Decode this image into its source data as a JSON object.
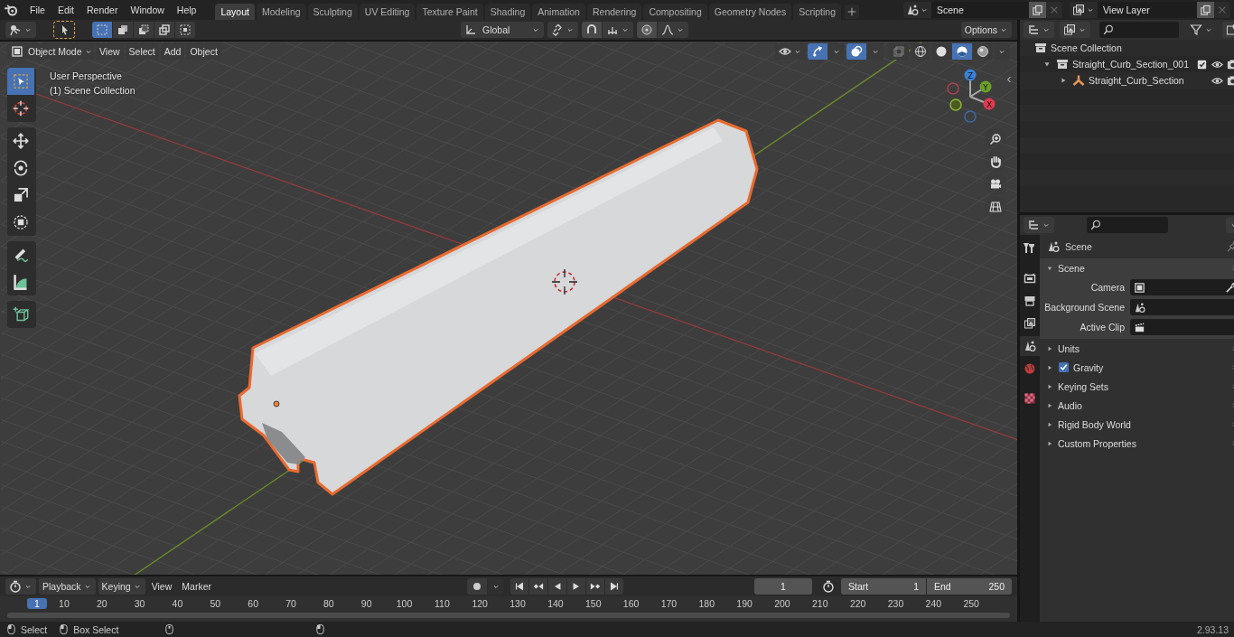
{
  "top_bar": {
    "menus": [
      "File",
      "Edit",
      "Render",
      "Window",
      "Help"
    ],
    "workspaces": [
      {
        "label": "Layout",
        "selected": true
      },
      {
        "label": "Modeling",
        "selected": false
      },
      {
        "label": "Sculpting",
        "selected": false
      },
      {
        "label": "UV Editing",
        "selected": false
      },
      {
        "label": "Texture Paint",
        "selected": false
      },
      {
        "label": "Shading",
        "selected": false
      },
      {
        "label": "Animation",
        "selected": false
      },
      {
        "label": "Rendering",
        "selected": false
      },
      {
        "label": "Compositing",
        "selected": false
      },
      {
        "label": "Geometry Nodes",
        "selected": false
      },
      {
        "label": "Scripting",
        "selected": false
      }
    ],
    "scene": "Scene",
    "view_layer": "View Layer"
  },
  "tool_header": {
    "select_modes": [
      {
        "kind": "set",
        "selected": true
      },
      {
        "kind": "extend",
        "selected": false
      },
      {
        "kind": "subtract",
        "selected": false
      },
      {
        "kind": "invert",
        "selected": false
      },
      {
        "kind": "intersect",
        "selected": false
      }
    ],
    "orientation": "Global",
    "options": "Options"
  },
  "viewport_header": {
    "mode": "Object Mode",
    "menus": [
      "View",
      "Select",
      "Add",
      "Object"
    ],
    "shading": [
      {
        "kind": "wireframe",
        "selected": false
      },
      {
        "kind": "solid",
        "selected": false
      },
      {
        "kind": "material",
        "selected": true
      },
      {
        "kind": "rendered",
        "selected": false
      }
    ]
  },
  "viewport": {
    "info": [
      "User Perspective",
      "(1) Scene Collection"
    ],
    "tools": [
      {
        "kind": "select",
        "selected": true
      },
      {
        "kind": "cursor",
        "selected": false
      },
      {
        "kind": "move",
        "selected": false
      },
      {
        "kind": "rotate",
        "selected": false
      },
      {
        "kind": "scale",
        "selected": false
      },
      {
        "kind": "transform",
        "selected": false
      },
      {
        "kind": "annotate",
        "selected": false
      },
      {
        "kind": "measure",
        "selected": false
      },
      {
        "kind": "add-cube",
        "selected": false
      }
    ],
    "gizmo_axes": [
      "Z",
      "Y",
      "X"
    ]
  },
  "outliner": {
    "rows": [
      {
        "label": "Scene Collection",
        "kind": "scene-collection",
        "children": [
          {
            "label": "Straight_Curb_Section_001",
            "kind": "collection",
            "expanded": true,
            "checked": true,
            "children": [
              {
                "label": "Straight_Curb_Section",
                "kind": "empty",
                "expanded": false
              }
            ]
          }
        ]
      }
    ]
  },
  "properties": {
    "tabs": [
      {
        "kind": "tool",
        "selected": false
      },
      {
        "kind": "render",
        "selected": false
      },
      {
        "kind": "output",
        "selected": false
      },
      {
        "kind": "view-layer",
        "selected": false
      },
      {
        "kind": "scene",
        "selected": true
      },
      {
        "kind": "world",
        "selected": false
      },
      {
        "kind": "texture",
        "selected": false
      }
    ],
    "context": "Scene",
    "panels": [
      {
        "label": "Scene",
        "expanded": true,
        "fields": [
          {
            "label": "Camera",
            "kind": "camera"
          },
          {
            "label": "Background Scene",
            "kind": "scene"
          },
          {
            "label": "Active Clip",
            "kind": "clip"
          }
        ]
      },
      {
        "label": "Units",
        "expanded": false
      },
      {
        "label": "Gravity",
        "expanded": false,
        "checkbox": {
          "checked": true
        }
      },
      {
        "label": "Keying Sets",
        "expanded": false
      },
      {
        "label": "Audio",
        "expanded": false
      },
      {
        "label": "Rigid Body World",
        "expanded": false
      },
      {
        "label": "Custom Properties",
        "expanded": false
      }
    ]
  },
  "timeline": {
    "menus": [
      {
        "label": "Playback",
        "dropdown": true
      },
      {
        "label": "Keying",
        "dropdown": true
      },
      {
        "label": "View",
        "dropdown": false
      },
      {
        "label": "Marker",
        "dropdown": false
      }
    ],
    "current_frame": "1",
    "start_label": "Start",
    "start": "1",
    "end_label": "End",
    "end": "250",
    "ruler": {
      "current": "1",
      "ticks": [
        "10",
        "20",
        "30",
        "40",
        "50",
        "60",
        "70",
        "80",
        "90",
        "100",
        "110",
        "120",
        "130",
        "140",
        "150",
        "160",
        "170",
        "180",
        "190",
        "200",
        "210",
        "220",
        "230",
        "240",
        "250"
      ]
    }
  },
  "status_bar": {
    "hints": [
      "Select",
      "Box Select"
    ],
    "version": "2.93.13"
  }
}
